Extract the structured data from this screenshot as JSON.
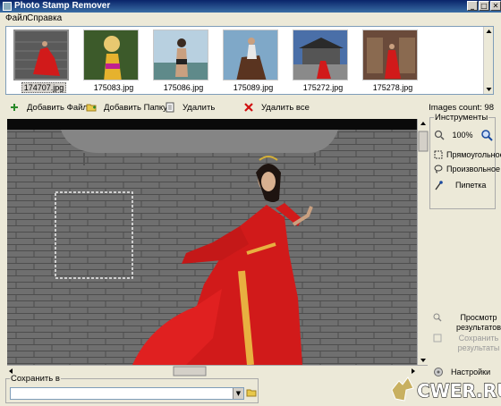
{
  "window": {
    "title": "Photo Stamp Remover"
  },
  "menu": {
    "file": "Файл",
    "help": "Справка"
  },
  "thumbnails": [
    {
      "name": "174707.jpg",
      "selected": true
    },
    {
      "name": "175083.jpg",
      "selected": false
    },
    {
      "name": "175086.jpg",
      "selected": false
    },
    {
      "name": "175089.jpg",
      "selected": false
    },
    {
      "name": "175272.jpg",
      "selected": false
    },
    {
      "name": "175278.jpg",
      "selected": false
    }
  ],
  "toolbar": {
    "add_file": "Добавить Файл",
    "add_folder": "Добавить Папку",
    "remove": "Удалить",
    "remove_all": "Удалить все",
    "images_count": "Images count: 98"
  },
  "tools": {
    "legend": "Инструменты",
    "zoom": "100%",
    "rectangular": "Прямоугольное",
    "freeform": "Произвольное",
    "pipette": "Пипетка"
  },
  "actions": {
    "preview": "Просмотр результатов",
    "save_results": "Сохранить результаты",
    "settings": "Настройки"
  },
  "save": {
    "legend": "Сохранить в",
    "value": ""
  },
  "watermark": "CWER.RU",
  "colors": {
    "title_bar": "#0a246a",
    "dress_red": "#d11a1a",
    "brick_gray": "#6d6d6d"
  }
}
